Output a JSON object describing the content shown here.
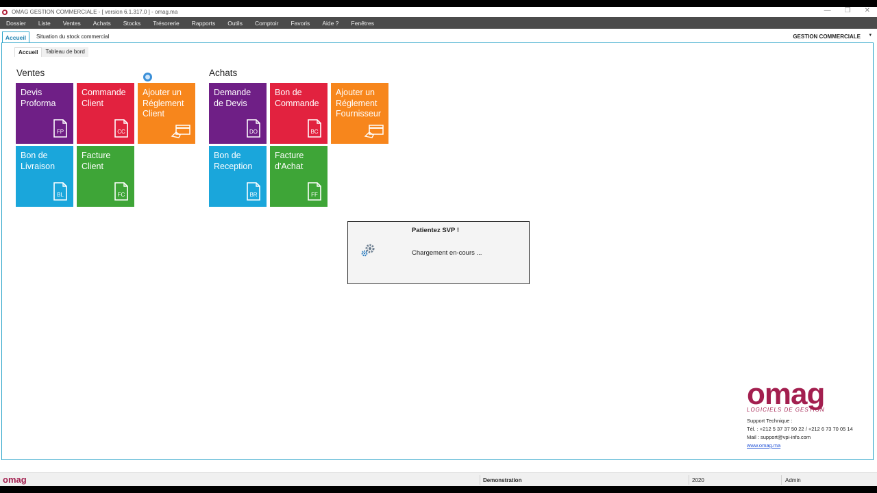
{
  "window": {
    "title": "OMAG GESTION COMMERCIALE - [ version 6.1.317.0 ] - omag.ma",
    "controls": [
      "—",
      "❐",
      "✕"
    ]
  },
  "menu": [
    "Dossier",
    "Liste",
    "Ventes",
    "Achats",
    "Stocks",
    "Trésorerie",
    "Rapports",
    "Outils",
    "Comptoir",
    "Favoris",
    "Aide ?",
    "Fenêtres"
  ],
  "tabs": {
    "accueil": "Accueil",
    "stock": "Situation du stock commercial",
    "module": "GESTION COMMERCIALE"
  },
  "subtabs": {
    "accueil": "Accueil",
    "tableau": "Tableau de bord"
  },
  "ventes": {
    "title": "Ventes",
    "tiles": [
      {
        "label": "Devis\nProforma",
        "code": "FP",
        "color": "#6f1f86"
      },
      {
        "label": "Commande\nClient",
        "code": "CC",
        "color": "#e2223f"
      },
      {
        "label": "Ajouter un\nRéglement\nClient",
        "code": "",
        "color": "#f7861c"
      },
      {
        "label": "Bon de\nLivraison",
        "code": "BL",
        "color": "#1aa6db"
      },
      {
        "label": "Facture\nClient",
        "code": "FC",
        "color": "#3ea537"
      }
    ]
  },
  "achats": {
    "title": "Achats",
    "tiles": [
      {
        "label": "Demande\nde Devis",
        "code": "DO",
        "color": "#6f1f86"
      },
      {
        "label": "Bon de\nCommande",
        "code": "BC",
        "color": "#e2223f"
      },
      {
        "label": "Ajouter un\nRéglement\nFournisseur",
        "code": "",
        "color": "#f7861c"
      },
      {
        "label": "Bon de\nReception",
        "code": "BR",
        "color": "#1aa6db"
      },
      {
        "label": "Facture\nd'Achat",
        "code": "FF",
        "color": "#3ea537"
      }
    ]
  },
  "dialog": {
    "title": "Patientez SVP !",
    "message": "Chargement en-cours ..."
  },
  "brand": {
    "logo": "omag",
    "tagline": "LOGICIELS DE GESTION",
    "support_title": "Support Technique :",
    "phone": "Tél. :  +212 5 37 37 50 22  /  +212 6 73 70 05 14",
    "mail": "Mail :  support@vpi-info.com",
    "website": "www.omag.ma"
  },
  "status": {
    "logo": "omag",
    "mode": "Demonstration",
    "year": "2020",
    "user": "Admin"
  }
}
